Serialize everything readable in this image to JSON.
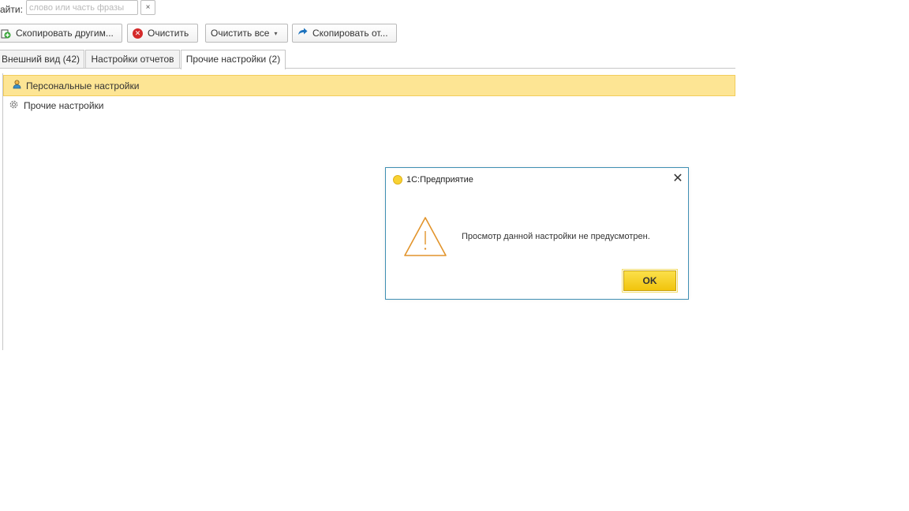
{
  "search": {
    "label": "айти:",
    "placeholder": "слово или часть фразы",
    "clear_symbol": "×"
  },
  "toolbar": {
    "copy_others_label": "Скопировать другим...",
    "clear_label": "Очистить",
    "clear_all_label": "Очистить все",
    "clear_all_caret": "▾",
    "copy_from_label": "Скопировать от..."
  },
  "tabs": [
    {
      "label": "Внешний вид (42)",
      "active": false
    },
    {
      "label": "Настройки отчетов",
      "active": false
    },
    {
      "label": "Прочие настройки (2)",
      "active": true
    }
  ],
  "tree": {
    "items": [
      {
        "label": "Персональные настройки",
        "icon": "user-icon",
        "selected": true
      },
      {
        "label": "Прочие настройки",
        "icon": "gear-icon",
        "selected": false
      }
    ]
  },
  "dialog": {
    "title": "1С:Предприятие",
    "close_symbol": "✕",
    "message": "Просмотр данной настройки не предусмотрен.",
    "ok_label": "OK",
    "icon": "warning-icon"
  },
  "colors": {
    "selection_background": "#fde594",
    "dialog_border": "#3f8fb3",
    "ok_button": "#f5cd17",
    "warning_icon": "#e2942b"
  }
}
